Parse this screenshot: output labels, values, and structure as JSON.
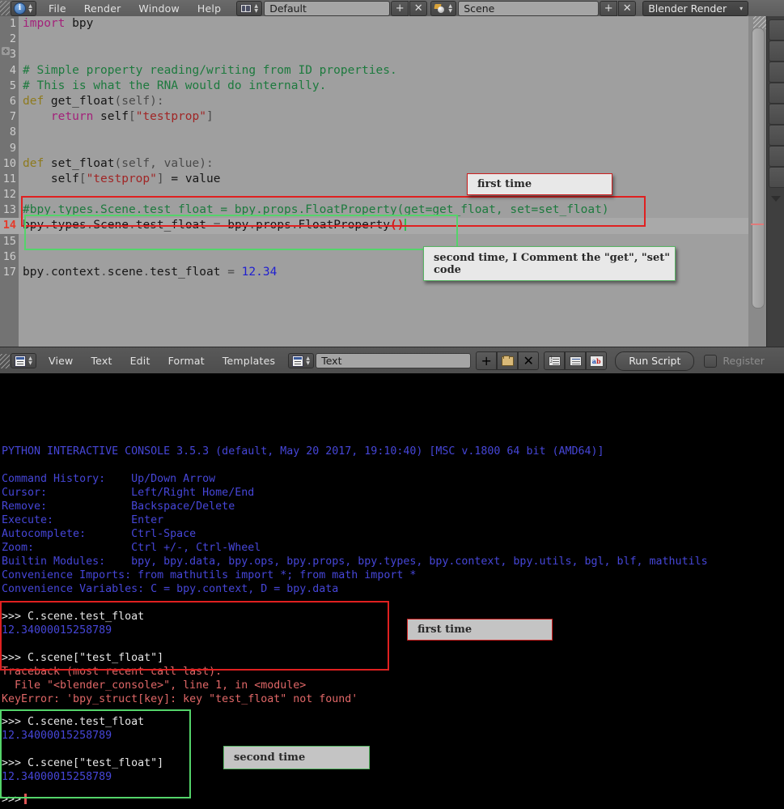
{
  "topbar": {
    "editor_icon": "info-icon",
    "menus": [
      "File",
      "Render",
      "Window",
      "Help"
    ],
    "screen_icon": "screen-layout-icon",
    "screen_name": "Default",
    "screen_add_label": "+",
    "screen_del_label": "✕",
    "scene_icon": "scene-icon",
    "scene_name": "Scene",
    "scene_add_label": "+",
    "scene_del_label": "✕",
    "render_engine": "Blender Render",
    "engine_caret": "▾"
  },
  "editor": {
    "gutter_drag_handle": "✥",
    "lines": [
      {
        "n": "1",
        "tokens": [
          {
            "t": "import ",
            "c": "kw2"
          },
          {
            "t": "bpy",
            "c": ""
          }
        ]
      },
      {
        "n": "2",
        "tokens": []
      },
      {
        "n": "3",
        "tokens": []
      },
      {
        "n": "4",
        "tokens": [
          {
            "t": "# Simple property reading/writing from ID properties.",
            "c": "cmt"
          }
        ]
      },
      {
        "n": "5",
        "tokens": [
          {
            "t": "# This is what the RNA would do internally.",
            "c": "cmt"
          }
        ]
      },
      {
        "n": "6",
        "tokens": [
          {
            "t": "def ",
            "c": "kw"
          },
          {
            "t": "get_float",
            "c": ""
          },
          {
            "t": "(self):",
            "c": "punct"
          }
        ]
      },
      {
        "n": "7",
        "tokens": [
          {
            "t": "    ",
            "c": ""
          },
          {
            "t": "return ",
            "c": "kw2"
          },
          {
            "t": "self",
            "c": ""
          },
          {
            "t": "[",
            "c": "punct"
          },
          {
            "t": "\"testprop\"",
            "c": "str"
          },
          {
            "t": "]",
            "c": "punct"
          }
        ]
      },
      {
        "n": "8",
        "tokens": []
      },
      {
        "n": "9",
        "tokens": []
      },
      {
        "n": "10",
        "tokens": [
          {
            "t": "def ",
            "c": "kw"
          },
          {
            "t": "set_float",
            "c": ""
          },
          {
            "t": "(self, value):",
            "c": "punct"
          }
        ]
      },
      {
        "n": "11",
        "tokens": [
          {
            "t": "    self",
            "c": ""
          },
          {
            "t": "[",
            "c": "punct"
          },
          {
            "t": "\"testprop\"",
            "c": "str"
          },
          {
            "t": "]",
            "c": "punct"
          },
          {
            "t": " = value",
            "c": ""
          }
        ]
      },
      {
        "n": "12",
        "tokens": []
      },
      {
        "n": "13",
        "tokens": [
          {
            "t": "#bpy.types.Scene.test_float = bpy.props.FloatProperty(get=get_float, set=set_float)",
            "c": "cmt"
          }
        ]
      },
      {
        "n": "14",
        "current": true,
        "tokens": [
          {
            "t": "bpy",
            "c": ""
          },
          {
            "t": ".",
            "c": "punct"
          },
          {
            "t": "types",
            "c": ""
          },
          {
            "t": ".",
            "c": "punct"
          },
          {
            "t": "Scene",
            "c": ""
          },
          {
            "t": ".",
            "c": "punct"
          },
          {
            "t": "test_float ",
            "c": ""
          },
          {
            "t": "= ",
            "c": "punct"
          },
          {
            "t": "bpy",
            "c": ""
          },
          {
            "t": ".",
            "c": "punct"
          },
          {
            "t": "props",
            "c": ""
          },
          {
            "t": ".",
            "c": "punct"
          },
          {
            "t": "FloatProperty",
            "c": ""
          },
          {
            "t": "()",
            "c": "paren-red"
          }
        ],
        "caret": true
      },
      {
        "n": "15",
        "tokens": []
      },
      {
        "n": "16",
        "tokens": []
      },
      {
        "n": "17",
        "tokens": [
          {
            "t": "bpy",
            "c": ""
          },
          {
            "t": ".",
            "c": "punct"
          },
          {
            "t": "context",
            "c": ""
          },
          {
            "t": ".",
            "c": "punct"
          },
          {
            "t": "scene",
            "c": ""
          },
          {
            "t": ".",
            "c": "punct"
          },
          {
            "t": "test_float ",
            "c": ""
          },
          {
            "t": "= ",
            "c": "punct"
          },
          {
            "t": "12.34",
            "c": "num"
          }
        ]
      }
    ],
    "callouts": [
      {
        "text": "first time",
        "color": "red"
      },
      {
        "text": "second time, I Comment the \"get\", \"set\" code",
        "color": "green"
      }
    ]
  },
  "footer": {
    "editor_icon": "text-editor-icon",
    "menus": [
      "View",
      "Text",
      "Edit",
      "Format",
      "Templates"
    ],
    "datablock_icon": "text-datablock-icon",
    "datablock_name": "Text",
    "new_label": "+",
    "open_icon": "folder-open-icon",
    "unlink_label": "✕",
    "line_numbers_icon": "line-numbers-icon",
    "word_wrap_icon": "word-wrap-icon",
    "syntax_highlight_icon": "syntax-highlight-icon",
    "run_script": "Run Script",
    "register_label": "Register"
  },
  "console": {
    "header": "PYTHON INTERACTIVE CONSOLE 3.5.3 (default, May 20 2017, 19:10:40) [MSC v.1800 64 bit (AMD64)]",
    "help_rows": [
      {
        "key": "Command History:",
        "value": "Up/Down Arrow"
      },
      {
        "key": "Cursor:",
        "value": "Left/Right Home/End"
      },
      {
        "key": "Remove:",
        "value": "Backspace/Delete"
      },
      {
        "key": "Execute:",
        "value": "Enter"
      },
      {
        "key": "Autocomplete:",
        "value": "Ctrl-Space"
      },
      {
        "key": "Zoom:",
        "value": "Ctrl +/-, Ctrl-Wheel"
      },
      {
        "key": "Builtin Modules:",
        "value": "bpy, bpy.data, bpy.ops, bpy.props, bpy.types, bpy.context, bpy.utils, bgl, blf, mathutils"
      },
      {
        "key": "Convenience Imports:",
        "value": "from mathutils import *; from math import *"
      },
      {
        "key": "Convenience Variables:",
        "value": "C = bpy.context, D = bpy.data"
      }
    ],
    "block_first": [
      {
        "text": ">>> C.scene.test_float",
        "c": "c-white"
      },
      {
        "text": "12.34000015258789",
        "c": "c-num"
      },
      {
        "text": "",
        "c": "c-white"
      },
      {
        "text": ">>> C.scene[\"test_float\"]",
        "c": "c-white"
      },
      {
        "text": "Traceback (most recent call last):",
        "c": "c-err"
      },
      {
        "text": "  File \"<blender_console>\", line 1, in <module>",
        "c": "c-err"
      },
      {
        "text": "KeyError: 'bpy_struct[key]: key \"test_float\" not found'",
        "c": "c-err"
      }
    ],
    "block_second": [
      {
        "text": ">>> C.scene.test_float",
        "c": "c-white"
      },
      {
        "text": "12.34000015258789",
        "c": "c-num"
      },
      {
        "text": "",
        "c": "c-white"
      },
      {
        "text": ">>> C.scene[\"test_float\"]",
        "c": "c-white"
      },
      {
        "text": "12.34000015258789",
        "c": "c-num"
      }
    ],
    "prompt": ">>>",
    "callouts": [
      {
        "text": "first time",
        "color": "red"
      },
      {
        "text": "second time",
        "color": "green"
      }
    ]
  },
  "colors": {
    "accent_red": "#e02020",
    "accent_green": "#54d46a",
    "console_bg": "#000000",
    "console_text": "#4646d8",
    "editor_bg": "#9f9f9f"
  }
}
